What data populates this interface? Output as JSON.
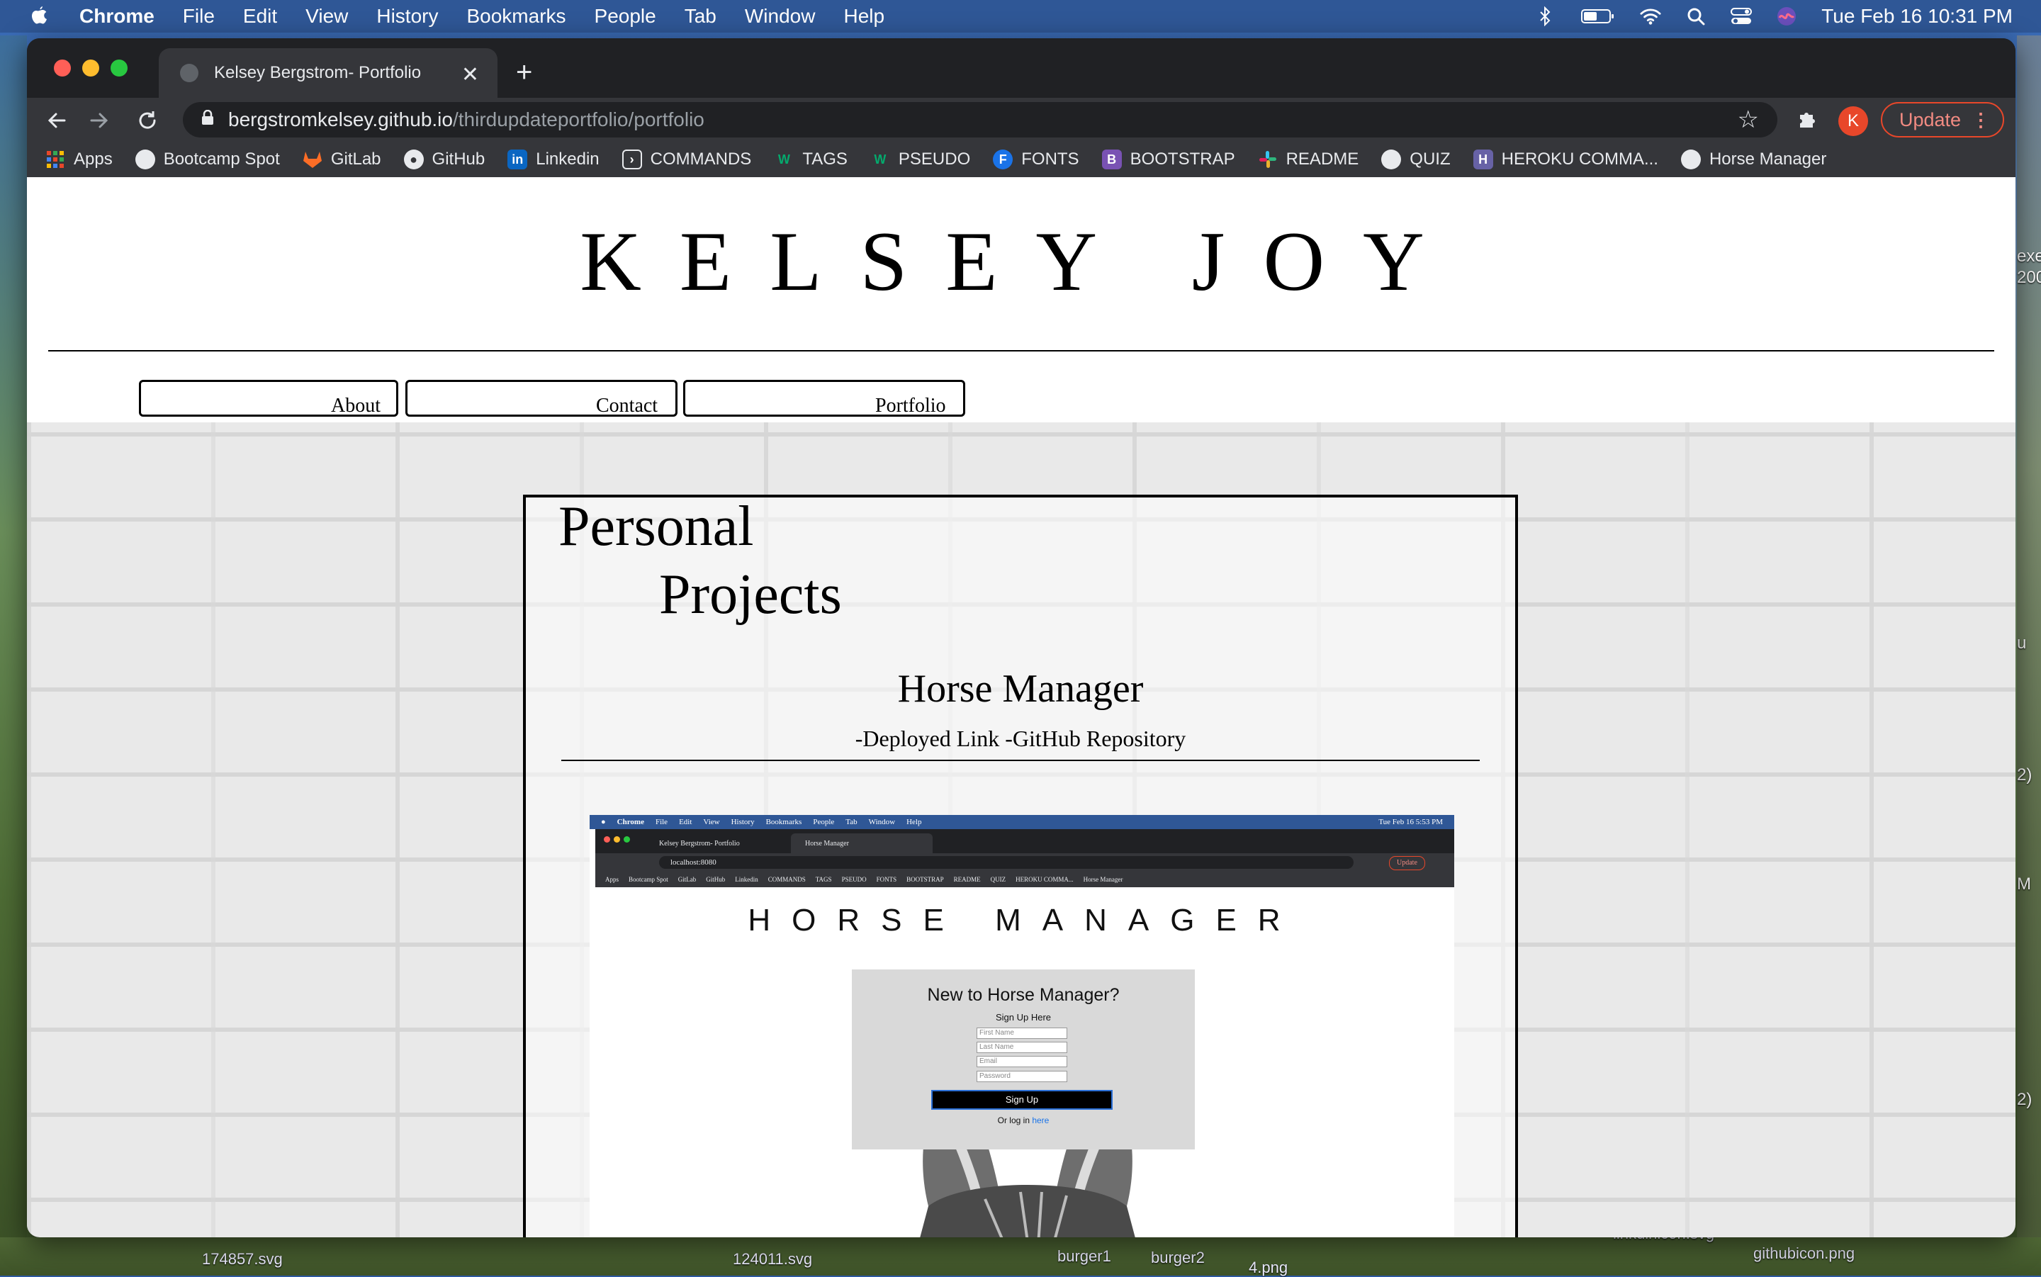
{
  "menubar": {
    "app": "Chrome",
    "items": [
      "File",
      "Edit",
      "View",
      "History",
      "Bookmarks",
      "People",
      "Tab",
      "Window",
      "Help"
    ],
    "clock": "Tue Feb 16  10:31 PM"
  },
  "browser": {
    "tab_title": "Kelsey Bergstrom- Portfolio",
    "url_host": "bergstromkelsey.github.io",
    "url_path": "/thirdupdateportfolio/portfolio",
    "update_label": "Update",
    "profile_initial": "K",
    "bookmarks": [
      {
        "label": "Apps",
        "icon": "apps-grid-icon",
        "color": "#e8472a"
      },
      {
        "label": "Bootcamp Spot",
        "icon": "globe-icon",
        "color": "#5f6368"
      },
      {
        "label": "GitLab",
        "icon": "gitlab-icon",
        "color": "#fc6d26"
      },
      {
        "label": "GitHub",
        "icon": "github-icon",
        "color": "#5f6368"
      },
      {
        "label": "Linkedin",
        "icon": "linkedin-icon",
        "color": "#0a66c2"
      },
      {
        "label": "COMMANDS",
        "icon": "terminal-icon",
        "color": "#5f6368"
      },
      {
        "label": "TAGS",
        "icon": "w3schools-icon",
        "color": "#04aa6d"
      },
      {
        "label": "PSEUDO",
        "icon": "w3schools-icon",
        "color": "#04aa6d"
      },
      {
        "label": "FONTS",
        "icon": "fonts-icon",
        "color": "#1a73e8"
      },
      {
        "label": "BOOTSTRAP",
        "icon": "bootstrap-icon",
        "color": "#7952b3"
      },
      {
        "label": "README",
        "icon": "slack-icon",
        "color": "#e01e5a"
      },
      {
        "label": "QUIZ",
        "icon": "globe-icon",
        "color": "#5f6368"
      },
      {
        "label": "HEROKU COMMA...",
        "icon": "heroku-icon",
        "color": "#6762a6"
      },
      {
        "label": "Horse Manager",
        "icon": "globe-icon",
        "color": "#5f6368"
      }
    ]
  },
  "site": {
    "brand": "KELSEY JOY",
    "nav": {
      "about": "About",
      "contact": "Contact",
      "portfolio": "Portfolio"
    },
    "section_line1": "Personal",
    "section_line2": "Projects",
    "project": {
      "title": "Horse Manager",
      "links": "-Deployed Link -GitHub Repository"
    }
  },
  "screenshot": {
    "menubar_items": [
      "Chrome",
      "File",
      "Edit",
      "View",
      "History",
      "Bookmarks",
      "People",
      "Tab",
      "Window",
      "Help"
    ],
    "clock": "Tue Feb 16  5:53 PM",
    "tab1": "Kelsey Bergstrom- Portfolio",
    "tab2": "Horse Manager",
    "url": "localhost:8080",
    "bookmarks": [
      "Apps",
      "Bootcamp Spot",
      "GitLab",
      "GitHub",
      "Linkedin",
      "COMMANDS",
      "TAGS",
      "PSEUDO",
      "FONTS",
      "BOOTSTRAP",
      "README",
      "QUIZ",
      "HEROKU COMMA...",
      "Horse Manager"
    ],
    "app_title": "HORSE MANAGER",
    "form_heading": "New to Horse Manager?",
    "form_sub": "Sign Up Here",
    "first_name": "First Name",
    "last_name": "Last Name",
    "email": "Email",
    "password": "Password",
    "signup": "Sign Up",
    "login_prefix": "Or log in ",
    "login_link": "here",
    "update": "Update"
  },
  "desktop": {
    "files": [
      "174857.svg",
      "124011.svg",
      "burger1",
      "burger2",
      "4.png",
      "linkdinicon.svg",
      "githubicon.png"
    ],
    "edge_fragments": [
      "exe",
      "200",
      "u",
      "2)",
      "M",
      "2)"
    ]
  }
}
